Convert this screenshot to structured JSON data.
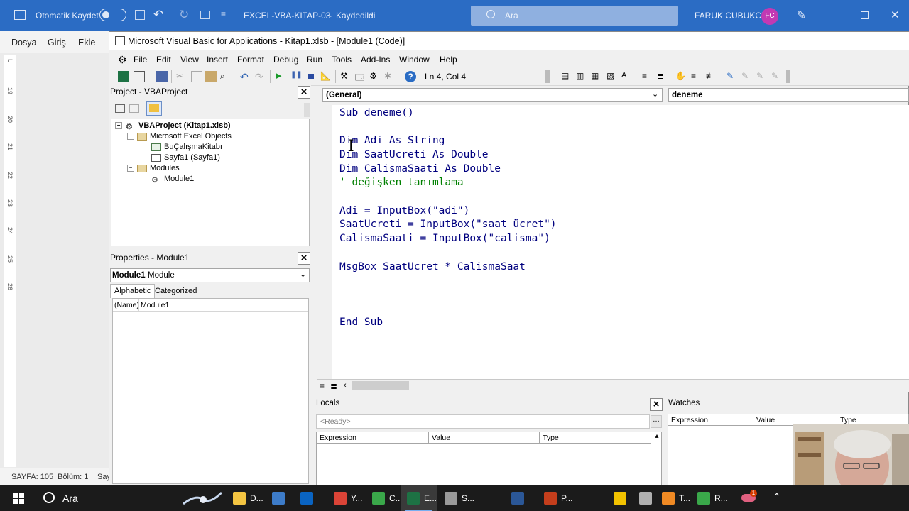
{
  "excel": {
    "autosave_label": "Otomatik Kaydet",
    "file_title": "EXCEL-VBA-KITAP-03",
    "saved_status": "Kaydedildi",
    "search_placeholder": "Ara",
    "user_name": "FARUK CUBUKCU",
    "user_initials": "FC",
    "ribbon_tabs": [
      "Dosya",
      "Giriş",
      "Ekle"
    ],
    "status": {
      "page": "SAYFA: 105",
      "section": "Bölüm: 1",
      "truncated": "Say"
    },
    "ruler_numbers": [
      "L",
      "19",
      "20",
      "21",
      "22",
      "23",
      "24",
      "25",
      "26"
    ]
  },
  "vbe": {
    "title": "Microsoft Visual Basic for Applications - Kitap1.xlsb - [Module1 (Code)]",
    "menu": [
      "File",
      "Edit",
      "View",
      "Insert",
      "Format",
      "Debug",
      "Run",
      "Tools",
      "Add-Ins",
      "Window",
      "Help"
    ],
    "cursor_position": "Ln 4, Col 4",
    "project": {
      "header": "Project - VBAProject",
      "tree": [
        {
          "label": "VBAProject (Kitap1.xlsb)",
          "icon": "vbaproject-icon"
        },
        {
          "label": "Microsoft Excel Objects",
          "icon": "folder-icon"
        },
        {
          "label": "BuÇalışmaKitabı",
          "icon": "workbook-icon"
        },
        {
          "label": "Sayfa1 (Sayfa1)",
          "icon": "worksheet-icon"
        },
        {
          "label": "Modules",
          "icon": "folder-icon"
        },
        {
          "label": "Module1",
          "icon": "module-icon"
        }
      ]
    },
    "properties": {
      "header": "Properties - Module1",
      "object_name": "Module1",
      "object_type": "Module",
      "tabs": [
        "Alphabetic",
        "Categorized"
      ],
      "rows": [
        {
          "name": "(Name)",
          "value": "Module1"
        }
      ]
    },
    "code": {
      "object_combo": "(General)",
      "procedure_combo": "deneme",
      "lines": [
        "Sub deneme()",
        "",
        "Dim Adi As String",
        "Dim SaatUcreti As Double",
        "Dim CalismaSaati As Double",
        "' değişken tanımlama",
        "",
        "Adi = InputBox(\"adi\")",
        "SaatUcreti = InputBox(\"saat ücret\")",
        "CalismaSaati = InputBox(\"calisma\")",
        "",
        "MsgBox SaatUcret * CalismaSaat",
        "",
        "",
        "",
        "End Sub"
      ]
    },
    "locals": {
      "header": "Locals",
      "ready": "<Ready>",
      "columns": [
        "Expression",
        "Value",
        "Type"
      ]
    },
    "watches": {
      "header": "Watches",
      "columns": [
        "Expression",
        "Value",
        "Type"
      ]
    }
  },
  "taskbar": {
    "search_label": "Ara",
    "apps": [
      {
        "label": "D...",
        "icon": "file-explorer-icon",
        "color": "#f4c542"
      },
      {
        "label": "",
        "icon": "screen-app-icon",
        "color": "#3d7cc9"
      },
      {
        "label": "",
        "icon": "outlook-icon",
        "color": "#0a64c2"
      },
      {
        "label": "Y...",
        "icon": "chrome-icon",
        "color": "#db4437"
      },
      {
        "label": "C...",
        "icon": "camtasia-icon",
        "color": "#3aa84a"
      },
      {
        "label": "E...",
        "icon": "excel-icon",
        "color": "#1d7244"
      },
      {
        "label": "S...",
        "icon": "snipping-icon",
        "color": "#9a9a9a"
      },
      {
        "label": "",
        "icon": "word-icon",
        "color": "#2b5797"
      },
      {
        "label": "P...",
        "icon": "powerpoint-icon",
        "color": "#c43e1c"
      },
      {
        "label": "",
        "icon": "notes-icon",
        "color": "#f2c200"
      },
      {
        "label": "",
        "icon": "recorder-icon",
        "color": "#b0b0b0"
      },
      {
        "label": "T...",
        "icon": "todo-icon",
        "color": "#f08a24"
      },
      {
        "label": "R...",
        "icon": "camtasia-recorder-icon",
        "color": "#3aa84a"
      }
    ],
    "tray_badge": "1"
  }
}
